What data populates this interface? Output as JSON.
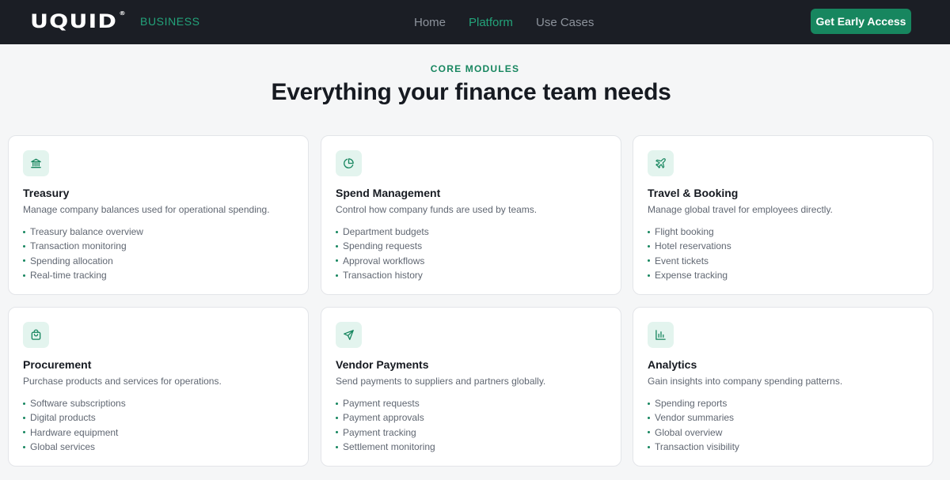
{
  "header": {
    "logo_text": "UQUID",
    "logo_reg": "®",
    "logo_sub": "BUSINESS",
    "nav": [
      {
        "label": "Home",
        "active": false
      },
      {
        "label": "Platform",
        "active": true
      },
      {
        "label": "Use Cases",
        "active": false
      }
    ],
    "cta_label": "Get Early Access"
  },
  "section": {
    "eyebrow": "CORE MODULES",
    "headline": "Everything your finance team needs"
  },
  "colors": {
    "header_bg": "#1b1e25",
    "accent": "#17865f",
    "accent_light": "#23a37a",
    "icon_bg": "#e3f4ee",
    "page_bg": "#f5f6f7"
  },
  "cards": [
    {
      "icon": "bank-icon",
      "title": "Treasury",
      "desc": "Manage company balances used for operational spending.",
      "items": [
        "Treasury balance overview",
        "Transaction monitoring",
        "Spending allocation",
        "Real-time tracking"
      ]
    },
    {
      "icon": "pie-chart-icon",
      "title": "Spend Management",
      "desc": "Control how company funds are used by teams.",
      "items": [
        "Department budgets",
        "Spending requests",
        "Approval workflows",
        "Transaction history"
      ]
    },
    {
      "icon": "plane-icon",
      "title": "Travel & Booking",
      "desc": "Manage global travel for employees directly.",
      "items": [
        "Flight booking",
        "Hotel reservations",
        "Event tickets",
        "Expense tracking"
      ]
    },
    {
      "icon": "shopping-bag-icon",
      "title": "Procurement",
      "desc": "Purchase products and services for operations.",
      "items": [
        "Software subscriptions",
        "Digital products",
        "Hardware equipment",
        "Global services"
      ]
    },
    {
      "icon": "send-icon",
      "title": "Vendor Payments",
      "desc": "Send payments to suppliers and partners globally.",
      "items": [
        "Payment requests",
        "Payment approvals",
        "Payment tracking",
        "Settlement monitoring"
      ]
    },
    {
      "icon": "bar-chart-icon",
      "title": "Analytics",
      "desc": "Gain insights into company spending patterns.",
      "items": [
        "Spending reports",
        "Vendor summaries",
        "Global overview",
        "Transaction visibility"
      ]
    }
  ]
}
